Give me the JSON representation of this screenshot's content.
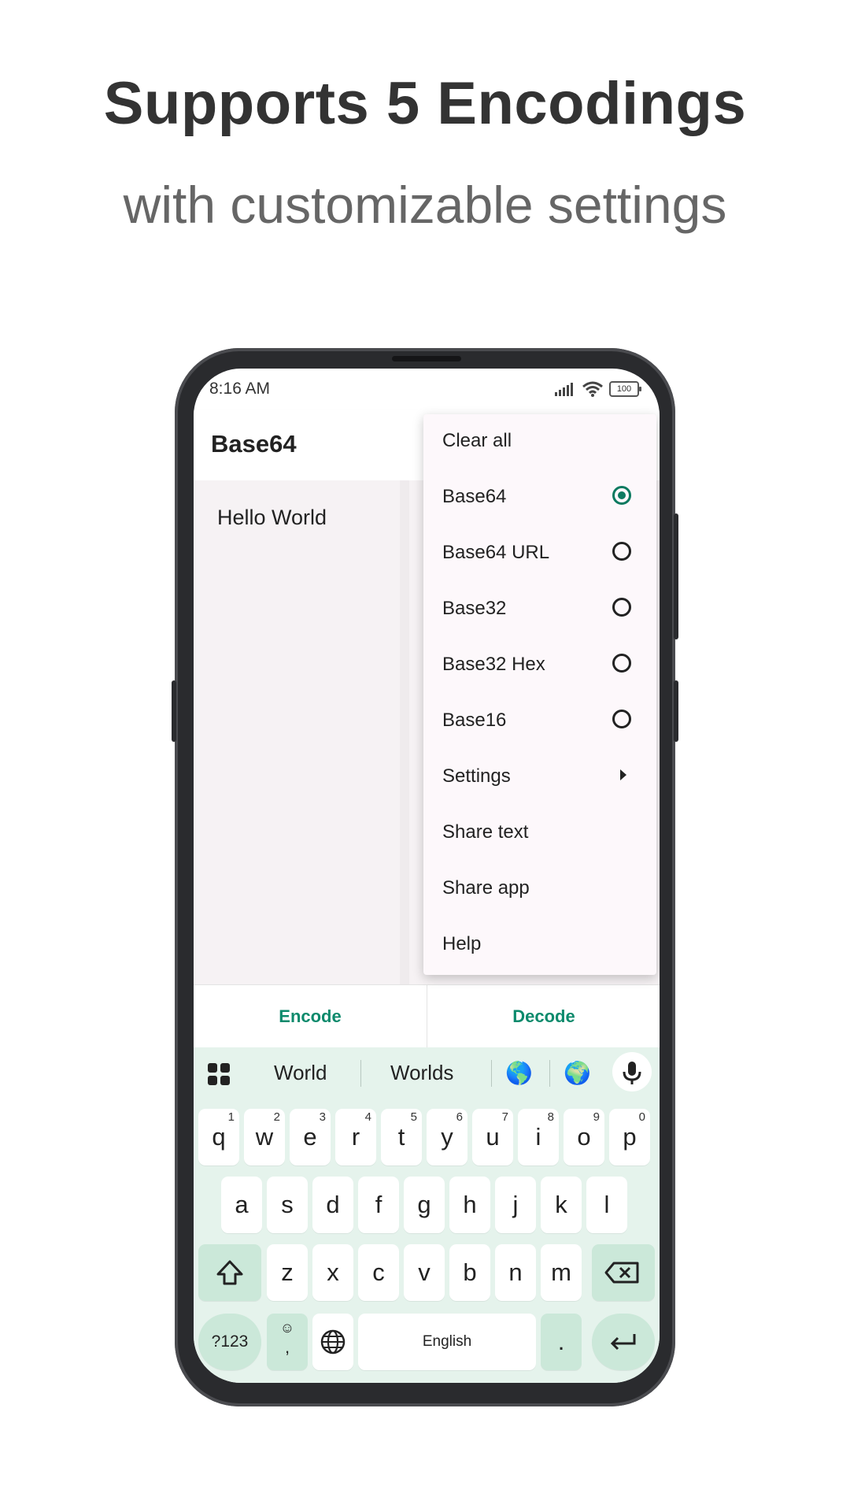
{
  "headline": "Supports 5 Encodings",
  "subheadline": "with customizable settings",
  "status_bar": {
    "time": "8:16 AM",
    "battery": "100"
  },
  "app_bar": {
    "title": "Base64"
  },
  "editor": {
    "text": "Hello World"
  },
  "actions": {
    "encode_label": "Encode",
    "decode_label": "Decode"
  },
  "menu": {
    "clear_all": "Clear all",
    "encodings": [
      {
        "label": "Base64",
        "selected": true
      },
      {
        "label": "Base64 URL",
        "selected": false
      },
      {
        "label": "Base32",
        "selected": false
      },
      {
        "label": "Base32 Hex",
        "selected": false
      },
      {
        "label": "Base16",
        "selected": false
      }
    ],
    "settings": "Settings",
    "share_text": "Share text",
    "share_app": "Share app",
    "help": "Help"
  },
  "keyboard": {
    "suggestions": [
      "World",
      "Worlds"
    ],
    "emoji_suggestions": [
      "🌎",
      "🌍"
    ],
    "row1": [
      {
        "key": "q",
        "num": "1"
      },
      {
        "key": "w",
        "num": "2"
      },
      {
        "key": "e",
        "num": "3"
      },
      {
        "key": "r",
        "num": "4"
      },
      {
        "key": "t",
        "num": "5"
      },
      {
        "key": "y",
        "num": "6"
      },
      {
        "key": "u",
        "num": "7"
      },
      {
        "key": "i",
        "num": "8"
      },
      {
        "key": "o",
        "num": "9"
      },
      {
        "key": "p",
        "num": "0"
      }
    ],
    "row2": [
      "a",
      "s",
      "d",
      "f",
      "g",
      "h",
      "j",
      "k",
      "l"
    ],
    "row3": [
      "z",
      "x",
      "c",
      "v",
      "b",
      "n",
      "m"
    ],
    "symbols_key": "?123",
    "emoji_key_top": "☺",
    "emoji_key_bottom": ",",
    "space_label": "English",
    "period_key": "."
  },
  "colors": {
    "accent": "#0c8a6c",
    "keyboard_bg": "#e5f3ec",
    "special_key": "#cbe8d9"
  }
}
